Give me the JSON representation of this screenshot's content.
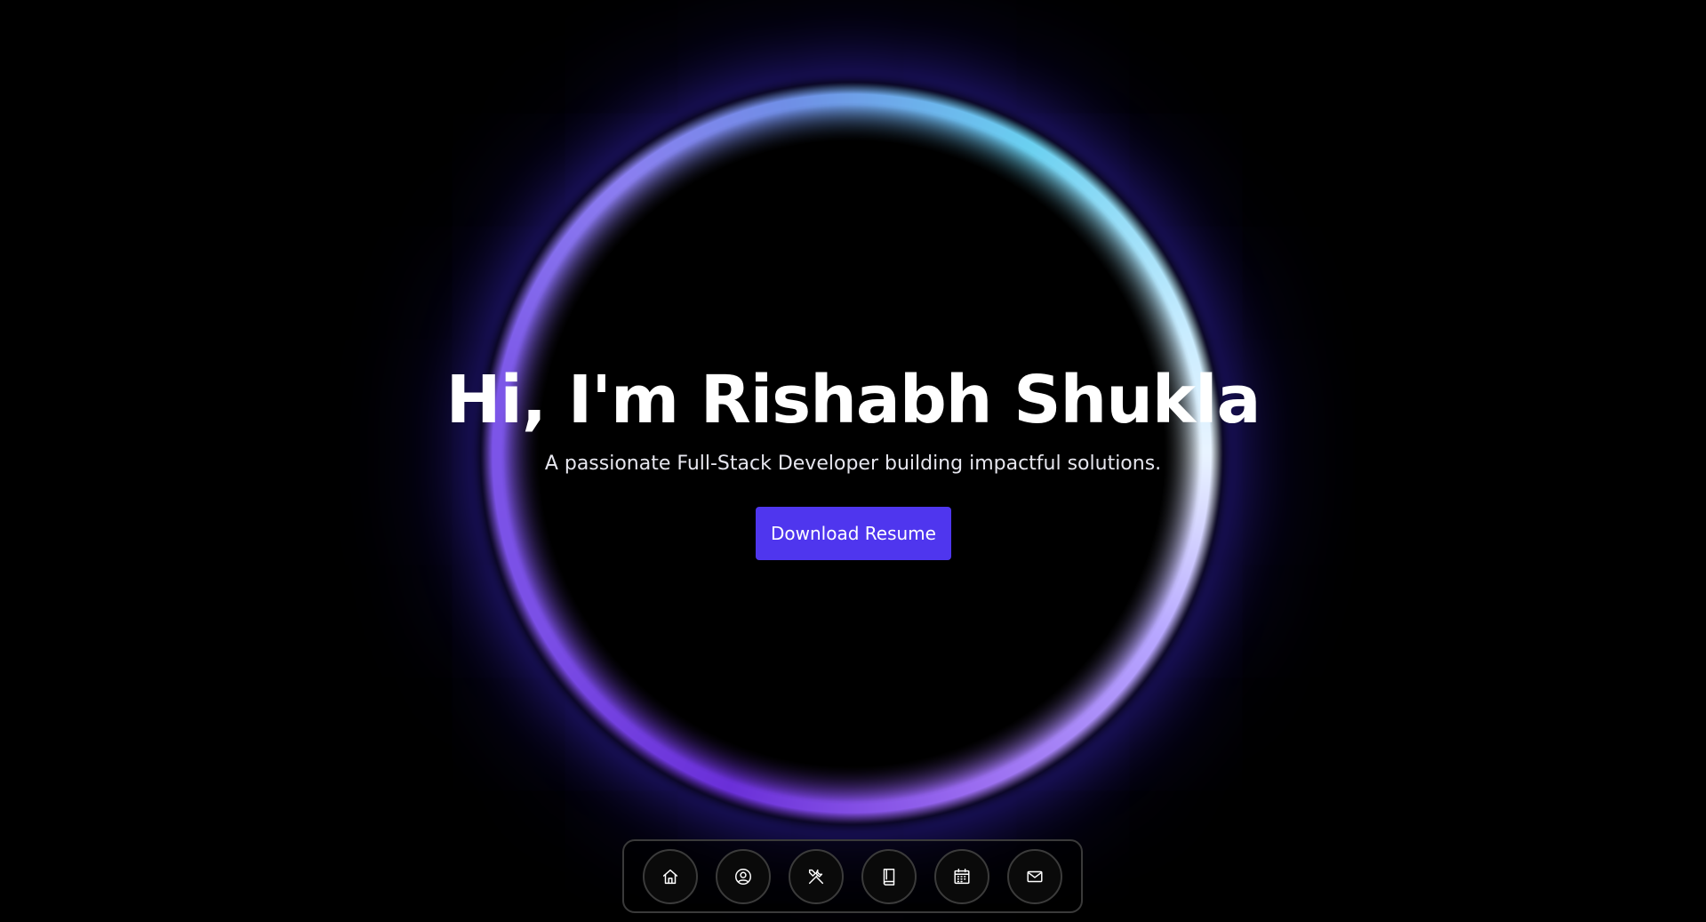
{
  "hero": {
    "title": "Hi, I'm Rishabh Shukla",
    "subtitle": "A passionate Full-Stack Developer building impactful solutions.",
    "cta_label": "Download Resume"
  },
  "dock": {
    "items": [
      {
        "icon": "home-icon"
      },
      {
        "icon": "user-icon"
      },
      {
        "icon": "tools-icon"
      },
      {
        "icon": "book-icon"
      },
      {
        "icon": "calendar-icon"
      },
      {
        "icon": "mail-icon"
      }
    ]
  },
  "colors": {
    "background": "#000000",
    "accent_button": "#4f36ee",
    "ring_purple": "#7b4fe6",
    "ring_cyan": "#6ad0f0"
  }
}
